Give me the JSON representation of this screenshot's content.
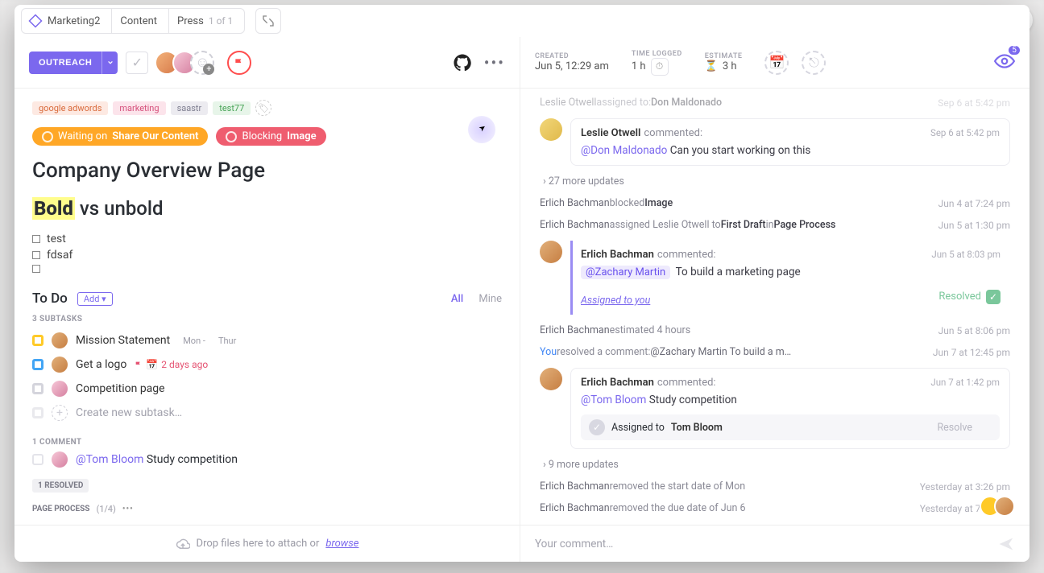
{
  "breadcrumbs": {
    "space": "Marketing2",
    "folder": "Content",
    "list": "Press",
    "count": "1 of 1"
  },
  "status": {
    "label": "OUTREACH"
  },
  "meta": {
    "created_label": "CREATED",
    "created_value": "Jun 5, 12:29 am",
    "time_label": "TIME LOGGED",
    "time_value": "1 h",
    "est_label": "ESTIMATE",
    "est_icon": "⏳",
    "est_value": "3 h",
    "watchers": "5"
  },
  "tags": [
    "google adwords",
    "marketing",
    "saastr",
    "test77"
  ],
  "statuses": {
    "waiting_prefix": "Waiting on",
    "waiting_target": "Share Our Content",
    "blocking_prefix": "Blocking",
    "blocking_target": "Image"
  },
  "title": "Company Overview Page",
  "doc": {
    "bold_word": "Bold",
    "rest": " vs unbold",
    "check1": "test",
    "check2": "fdsaf"
  },
  "todo": {
    "heading": "To Do",
    "add": "Add ▾",
    "filter_all": "All",
    "filter_mine": "Mine",
    "subtasks_label": "3 SUBTASKS",
    "items": [
      {
        "name": "Mission Statement",
        "date1": "Mon -",
        "date2": "Thur",
        "status": "yellow"
      },
      {
        "name": "Get a logo",
        "overdue": "2 days ago",
        "status": "blue"
      },
      {
        "name": "Competition page",
        "status": "grey"
      }
    ],
    "new_placeholder": "Create new subtask…"
  },
  "comments": {
    "label": "1 COMMENT",
    "mention": "@Tom Bloom",
    "text": "Study competition",
    "resolved": "1 RESOLVED"
  },
  "process": {
    "label": "PAGE PROCESS",
    "count": "(1/4)"
  },
  "dropzone": {
    "pre": "Drop files here to attach or ",
    "link": "browse"
  },
  "activity": {
    "line0": {
      "who": "Leslie Otwell",
      "verb": " assigned to: ",
      "target": "Don Maldonado",
      "ts": "Sep 6 at 5:42 pm"
    },
    "c1": {
      "name": "Leslie Otwell",
      "verb": "commented:",
      "ts": "Sep 6 at 5:42 pm",
      "mention": "@Don Maldonado",
      "body": "Can you start working on this"
    },
    "more1": "27 more updates",
    "line1": {
      "who": "Erlich Bachman",
      "verb": " blocked ",
      "target": "Image",
      "ts": "Jun 4 at 7:24 pm"
    },
    "line2": {
      "who": "Erlich Bachman",
      "verb": " assigned Leslie Otwell to ",
      "target": "First Draft",
      "mid": " in ",
      "target2": "Page Process",
      "ts": "Jun 5 at 1:30 pm"
    },
    "c2": {
      "name": "Erlich Bachman",
      "verb": "commented:",
      "ts": "Jun 5 at 8:03 pm",
      "mention": "@Zachary Martin",
      "body": "To build a marketing page",
      "assigned_note": "Assigned to you",
      "resolved_label": "Resolved"
    },
    "line3": {
      "who": "Erlich Bachman",
      "verb": " estimated 4 hours",
      "ts": "Jun 5 at 8:06 pm"
    },
    "line4": {
      "who": "You",
      "verb": " resolved a comment: ",
      "rest": "@Zachary Martin To build a m…",
      "ts": "Jun 7 at 12:45 pm"
    },
    "c3": {
      "name": "Erlich Bachman",
      "verb": "commented:",
      "ts": "Jun 7 at 1:42 pm",
      "mention": "@Tom Bloom",
      "body": "Study competition",
      "assigned_pre": "Assigned to",
      "assigned_name": "Tom Bloom",
      "resolve_label": "Resolve"
    },
    "more2": "9 more updates",
    "line5": {
      "who": "Erlich Bachman",
      "verb": " removed the start date of Mon",
      "ts": "Yesterday at 3:26 pm"
    },
    "line6": {
      "who": "Erlich Bachman",
      "verb": " removed the due date of Jun 6",
      "ts": "Yesterday at 7:15 pm"
    }
  },
  "comment_input": "Your comment…"
}
